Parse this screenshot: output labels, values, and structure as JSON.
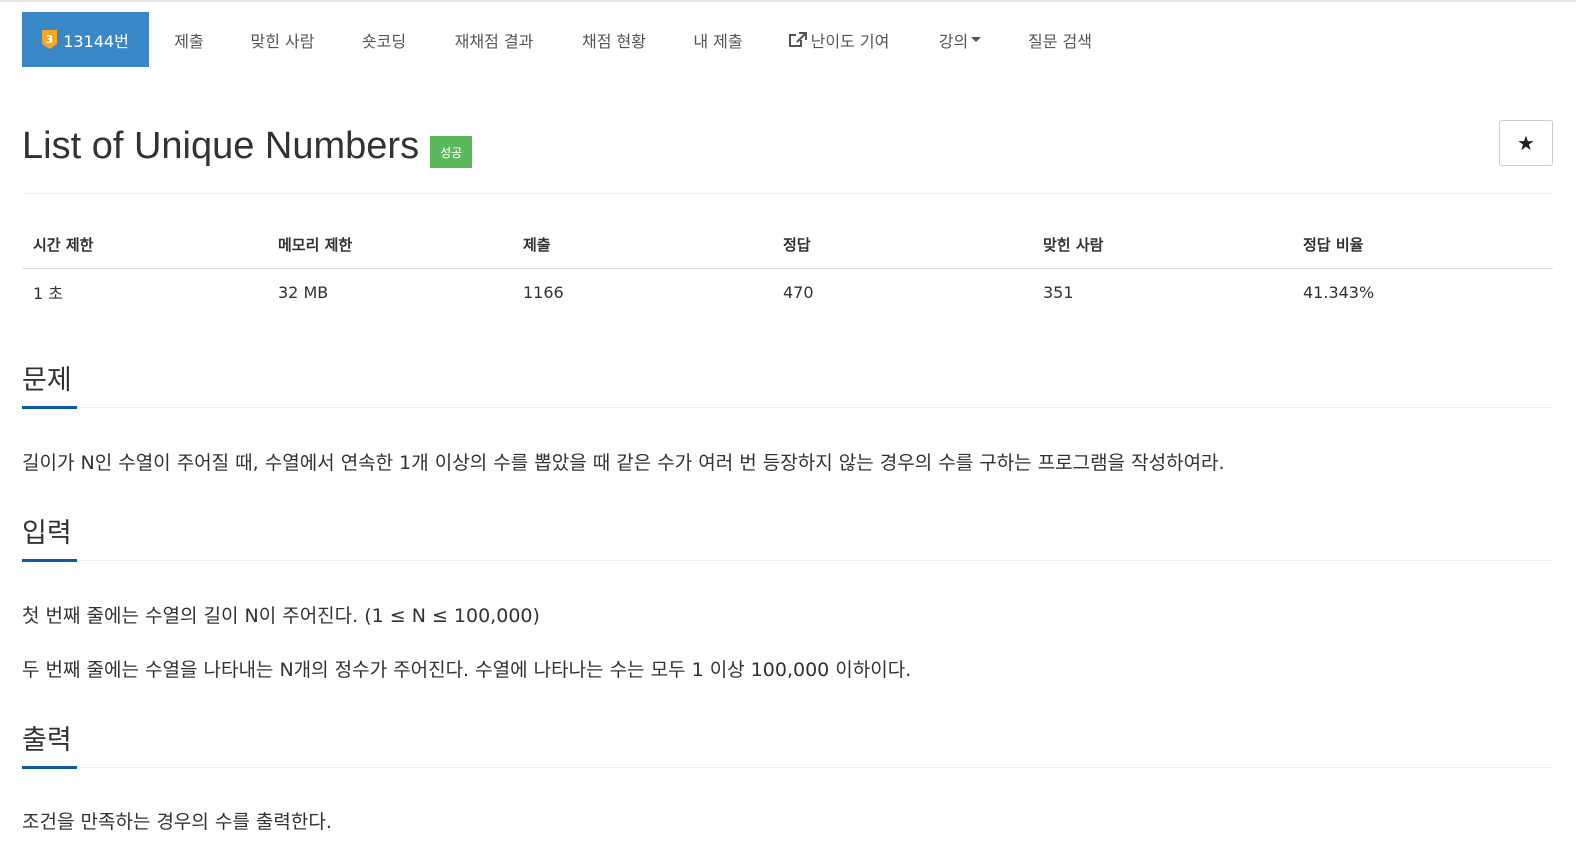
{
  "nav": {
    "problem_tab": "13144번",
    "tier_badge": "3",
    "items": [
      "제출",
      "맞힌 사람",
      "숏코딩",
      "재채점 결과",
      "채점 현황",
      "내 제출",
      "난이도 기여",
      "강의",
      "질문 검색"
    ],
    "tier_color": "#f5a623",
    "active_color": "#3a87c8"
  },
  "title": "List of Unique Numbers",
  "status_badge": "성공",
  "star_icon": "★",
  "stats": {
    "headers": [
      "시간 제한",
      "메모리 제한",
      "제출",
      "정답",
      "맞힌 사람",
      "정답 비율"
    ],
    "values": [
      "1 초",
      "32 MB",
      "1166",
      "470",
      "351",
      "41.343%"
    ]
  },
  "sections": {
    "problem": {
      "title": "문제",
      "text": "길이가 N인 수열이 주어질 때, 수열에서 연속한 1개 이상의 수를 뽑았을 때 같은 수가 여러 번 등장하지 않는 경우의 수를 구하는 프로그램을 작성하여라."
    },
    "input": {
      "title": "입력",
      "lines": [
        "첫 번째 줄에는 수열의 길이 N이 주어진다. (1 ≤ N ≤ 100,000)",
        "두 번째 줄에는 수열을 나타내는 N개의 정수가 주어진다. 수열에 나타나는 수는 모두 1 이상 100,000 이하이다."
      ]
    },
    "output": {
      "title": "출력",
      "text": "조건을 만족하는 경우의 수를 출력한다."
    }
  }
}
